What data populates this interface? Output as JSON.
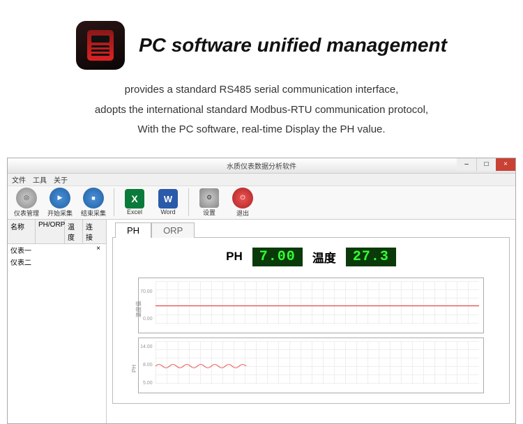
{
  "hero": {
    "title": "PC software unified management"
  },
  "desc": {
    "line1": "provides a standard RS485 serial communication interface,",
    "line2": "adopts the international standard Modbus-RTU communication protocol,",
    "line3": "With the PC software, real-time Display the PH value."
  },
  "window": {
    "title": "水质仪表数据分析软件"
  },
  "menubar": {
    "m1": "文件",
    "m2": "工具",
    "m3": "关于"
  },
  "toolbar": {
    "b1": "仪表管理",
    "b2": "开始采集",
    "b3": "结束采集",
    "b4": "Excel",
    "b5": "Word",
    "b6": "设置",
    "b7": "退出"
  },
  "sidebar": {
    "h1": "名称",
    "h2": "PH/ORP",
    "h3": "温度",
    "h4": "连接",
    "r1": "仪表一",
    "r2": "仪表二",
    "r1mark": "×"
  },
  "tabs": {
    "t1": "PH",
    "t2": "ORP"
  },
  "readout": {
    "ph_label": "PH",
    "ph_value": "7.00",
    "temp_label": "温度",
    "temp_value": "27.3"
  },
  "chart_data": [
    {
      "type": "line",
      "title": "",
      "xlabel": "",
      "ylabel": "温度",
      "ylim": [
        0,
        70
      ],
      "series": [
        {
          "name": "温度",
          "values": [
            27.3
          ]
        }
      ]
    },
    {
      "type": "line",
      "title": "",
      "xlabel": "",
      "ylabel": "PH",
      "ylim": [
        0,
        14
      ],
      "series": [
        {
          "name": "PH",
          "values": [
            7.0,
            7.05,
            6.98,
            7.02,
            7.0,
            7.03,
            6.99,
            7.0
          ]
        }
      ]
    }
  ],
  "chart1": {
    "y1": "70.00",
    "y3": "0.00",
    "ylabel": "温度值"
  },
  "chart2": {
    "y1": "14.00",
    "y2": "8.00",
    "y3": "5.00",
    "ylabel": "PH"
  }
}
